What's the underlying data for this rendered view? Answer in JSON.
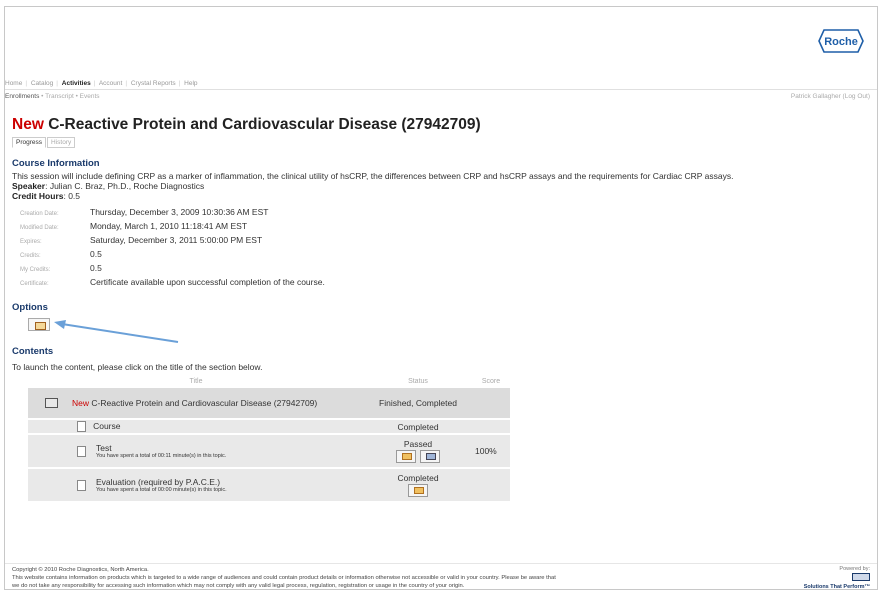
{
  "logo": {
    "text": "Roche"
  },
  "nav": {
    "items": [
      "Home",
      "Catalog",
      "Activities",
      "Account",
      "Crystal Reports",
      "Help"
    ]
  },
  "subnav": {
    "items": [
      "Enrollments",
      "Transcript",
      "Events"
    ]
  },
  "user": {
    "label": "Patrick Gallagher (Log Out)"
  },
  "title": {
    "new": "New",
    "text": "C-Reactive Protein and Cardiovascular Disease (27942709)"
  },
  "tabs": [
    "Progress",
    "History"
  ],
  "course_info": {
    "heading": "Course Information",
    "description": "This session will include defining CRP as a marker of inflammation, the clinical utility of hsCRP, the differences between CRP and hsCRP assays and the requirements for Cardiac CRP assays.",
    "speaker_label": "Speaker",
    "speaker_value": ": Julian C. Braz, Ph.D., Roche Diagnostics",
    "credit_label": "Credit Hours",
    "credit_value": ": 0.5",
    "meta": [
      {
        "k": "Creation Date:",
        "v": "Thursday, December 3, 2009 10:30:36 AM EST"
      },
      {
        "k": "Modified Date:",
        "v": "Monday, March 1, 2010 11:18:41 AM EST"
      },
      {
        "k": "Expires:",
        "v": "Saturday, December 3, 2011 5:00:00 PM EST"
      },
      {
        "k": "Credits:",
        "v": "0.5"
      },
      {
        "k": "My Credits:",
        "v": "0.5"
      },
      {
        "k": "Certificate:",
        "v": "Certificate available upon successful completion of the course."
      }
    ]
  },
  "options": {
    "heading": "Options",
    "button_icon": "certificate-icon"
  },
  "contents": {
    "heading": "Contents",
    "instruction": "To launch the content, please click on the title of the section below.",
    "columns": [
      "Title",
      "Status",
      "Score"
    ],
    "rows": [
      {
        "new": "New",
        "title": "C-Reactive Protein and Cardiovascular Disease (27942709)",
        "status": "Finished, Completed",
        "score": ""
      },
      {
        "title": "Course",
        "status": "Completed",
        "score": ""
      },
      {
        "title": "Test",
        "note": "You have spent a total of 00:11 minute(s) in this topic.",
        "status": "Passed",
        "score": "100%"
      },
      {
        "title": "Evaluation (required by P.A.C.E.)",
        "note": "You have spent a total of 00:00 minute(s) in this topic.",
        "status": "Completed",
        "score": ""
      }
    ]
  },
  "footer": {
    "copyright": "Copyright © 2010 Roche Diagnostics, North America.",
    "line1": "This website contains information on products which is targeted to a wide range of audiences and could contain product details or information otherwise not accessible or valid in your country. Please be aware that",
    "line2": "we do not take any responsibility for accessing such information which may not comply with any valid legal process, regulation, registration or usage in the country of your origin.",
    "powered": "Powered by:",
    "stp": "Solutions That Perform™"
  }
}
